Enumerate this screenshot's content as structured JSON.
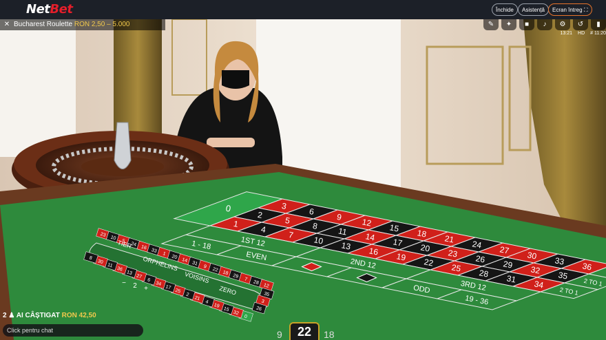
{
  "topbar": {
    "logo_main": "Net",
    "logo_accent": "Bet",
    "buttons": [
      "Închide",
      "Asistență",
      "Ecran întreg"
    ]
  },
  "hud": {
    "table_name": "Bucharest Roulette",
    "limits": "RON 2,50 – 5.000",
    "time": "13:21",
    "quality": "HD",
    "round": "# 11:20"
  },
  "table": {
    "zero": "0",
    "rows": [
      [
        "3",
        "6",
        "9",
        "12",
        "15",
        "18",
        "21",
        "24",
        "27",
        "30",
        "33",
        "36"
      ],
      [
        "2",
        "5",
        "8",
        "11",
        "14",
        "17",
        "20",
        "23",
        "26",
        "29",
        "32",
        "35"
      ],
      [
        "1",
        "4",
        "7",
        "10",
        "13",
        "16",
        "19",
        "22",
        "25",
        "28",
        "31",
        "34"
      ]
    ],
    "red_numbers": [
      1,
      3,
      5,
      7,
      9,
      12,
      14,
      16,
      18,
      19,
      21,
      23,
      25,
      27,
      30,
      32,
      34,
      36
    ],
    "column_bet": "2 TO 1",
    "dozens": [
      "1ST 12",
      "2ND 12",
      "3RD 12"
    ],
    "outside": [
      "1 - 18",
      "EVEN",
      "ODD",
      "19 - 36"
    ],
    "racetrack": {
      "tier": "TIER",
      "orphelins": "ORPHELINS",
      "voisins": "VOISINS",
      "zero": "ZERO",
      "minus": "−",
      "count": "2",
      "plus": "+",
      "numbers": [
        "23",
        "10",
        "5",
        "24",
        "16",
        "33",
        "1",
        "20",
        "14",
        "31",
        "9",
        "22",
        "18",
        "29",
        "7",
        "28",
        "12",
        "35",
        "3",
        "26",
        "0",
        "32",
        "15",
        "19",
        "4",
        "21",
        "2",
        "25",
        "17",
        "34",
        "6",
        "27",
        "13",
        "36",
        "11",
        "30",
        "8"
      ]
    }
  },
  "bottom": {
    "win_prefix": "2",
    "win_label": "AI CÂȘTIGAT",
    "win_amount": "RON 42,50",
    "chat_placeholder": "Click pentru chat",
    "last_result": "22",
    "prev_left": "9",
    "prev_right": "18"
  },
  "colors": {
    "felt": "#2e8a3c",
    "red": "#d0201a",
    "black": "#151515",
    "accent": "#e8742b"
  }
}
